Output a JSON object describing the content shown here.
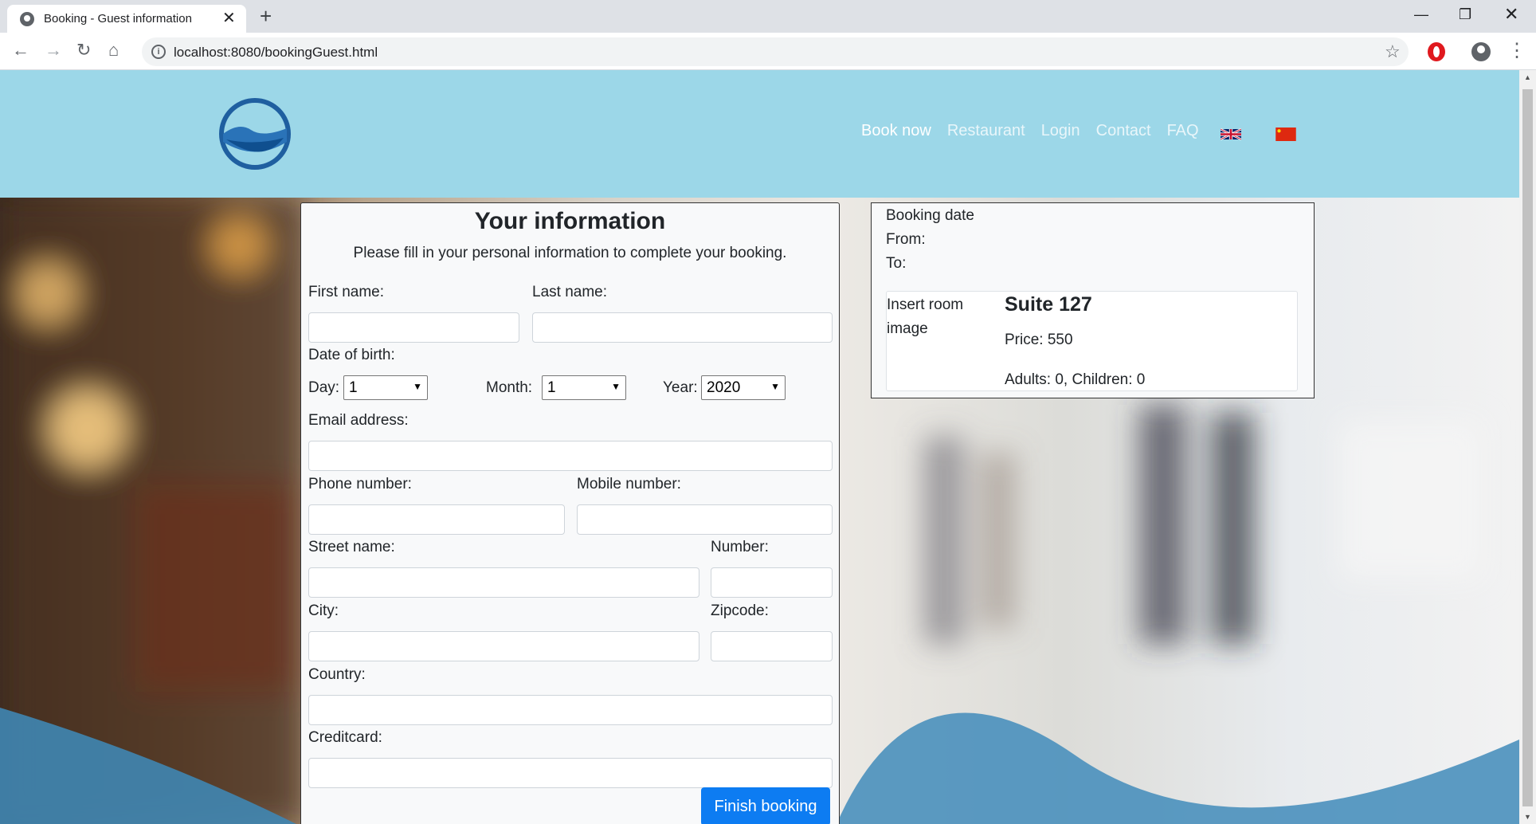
{
  "browser": {
    "tab_title": "Booking - Guest information",
    "url": "localhost:8080/bookingGuest.html"
  },
  "header": {
    "nav": [
      "Book now",
      "Restaurant",
      "Login",
      "Contact",
      "FAQ"
    ]
  },
  "form": {
    "title": "Your information",
    "subtitle": "Please fill in your personal information to complete your booking.",
    "first_name_label": "First name:",
    "last_name_label": "Last name:",
    "dob_label": "Date of birth:",
    "day_label": "Day:",
    "day_value": "1",
    "month_label": "Month:",
    "month_value": "1",
    "year_label": "Year:",
    "year_value": "2020",
    "email_label": "Email address:",
    "phone_label": "Phone number:",
    "mobile_label": "Mobile number:",
    "street_label": "Street name:",
    "number_label": "Number:",
    "city_label": "City:",
    "zip_label": "Zipcode:",
    "country_label": "Country:",
    "creditcard_label": "Creditcard:",
    "submit_label": "Finish booking"
  },
  "summary": {
    "heading": "Booking date",
    "from_label": "From:",
    "to_label": "To:",
    "room_image_alt": "Insert room image",
    "room_name": "Suite 127",
    "price": "Price: 550",
    "occupancy": "Adults: 0, Children: 0"
  },
  "colors": {
    "header_bg": "#9cd7e8",
    "primary_button": "#0d7cf2"
  }
}
